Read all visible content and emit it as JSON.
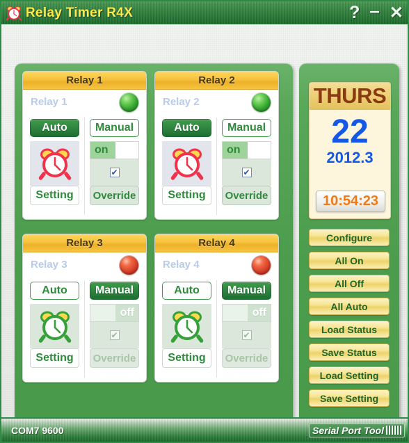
{
  "window": {
    "title": "Relay Timer R4X",
    "icon": "alarm-clock-icon",
    "help_label": "?",
    "minimize_label": "–",
    "close_label": "✕"
  },
  "relays": [
    {
      "header": "Relay 1",
      "name": "Relay 1",
      "led": "on",
      "mode": "Auto",
      "auto_label": "Auto",
      "manual_label": "Manual",
      "setting_label": "Setting",
      "override_label": "Override",
      "toggle_state": "on",
      "toggle_label": "on",
      "override_checked": true,
      "clock_color": "#f0324b"
    },
    {
      "header": "Relay 2",
      "name": "Relay 2",
      "led": "on",
      "mode": "Auto",
      "auto_label": "Auto",
      "manual_label": "Manual",
      "setting_label": "Setting",
      "override_label": "Override",
      "toggle_state": "on",
      "toggle_label": "on",
      "override_checked": true,
      "clock_color": "#f0324b"
    },
    {
      "header": "Relay 3",
      "name": "Relay 3",
      "led": "off",
      "mode": "Manual",
      "auto_label": "Auto",
      "manual_label": "Manual",
      "setting_label": "Setting",
      "override_label": "Override",
      "toggle_state": "off",
      "toggle_label": "off",
      "override_checked": true,
      "clock_color": "#36a03a"
    },
    {
      "header": "Relay 4",
      "name": "Relay 4",
      "led": "off",
      "mode": "Manual",
      "auto_label": "Auto",
      "manual_label": "Manual",
      "setting_label": "Setting",
      "override_label": "Override",
      "toggle_state": "off",
      "toggle_label": "off",
      "override_checked": true,
      "clock_color": "#36a03a"
    }
  ],
  "date_card": {
    "day_of_week": "THURS",
    "day": "22",
    "year_month": "2012.3",
    "time": "10:54:23"
  },
  "actions": [
    {
      "label": "Configure"
    },
    {
      "label": "All On"
    },
    {
      "label": "All Off"
    },
    {
      "label": "All Auto"
    },
    {
      "label": "Load Status"
    },
    {
      "label": "Save Status"
    },
    {
      "label": "Load Setting"
    },
    {
      "label": "Save Setting"
    }
  ],
  "statusbar": {
    "com": "COM7 9600",
    "brand": "Serial Port Tool"
  },
  "colors": {
    "panel_green": "#4c9c4e",
    "header_gold": "#f6c23c",
    "accent_blue": "#1558e8",
    "time_orange": "#f07a18",
    "title_yellow": "#ffe84a"
  }
}
